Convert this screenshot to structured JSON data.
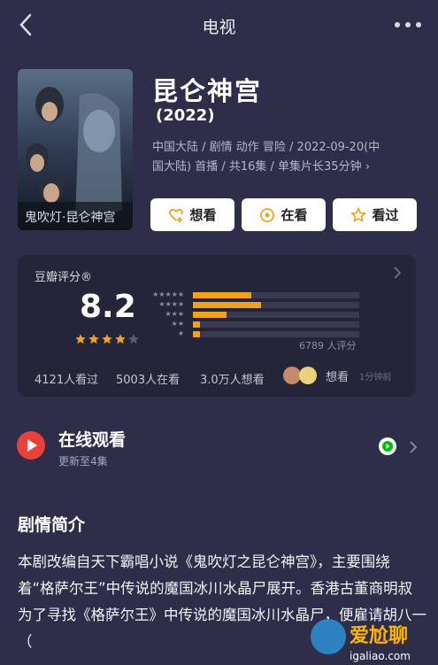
{
  "header": {
    "title": "电视"
  },
  "movie": {
    "title": "昆仑神宫",
    "year": "(2022)",
    "meta_line1": "中国大陆 / 剧情 动作 冒险 / 2022-09-20(中",
    "meta_line2": "国大陆) 首播 / 共16集 / 单集片长35分钟 ›",
    "poster_text": "鬼吹灯·昆仑神宫"
  },
  "actions": {
    "want": "想看",
    "watching": "在看",
    "watched": "看过"
  },
  "rating": {
    "section_title": "豆瓣评分®",
    "score": "8.2",
    "stars": 4,
    "distribution": [
      {
        "stars": "★★★★★",
        "pct": 35
      },
      {
        "stars": "★★★★",
        "pct": 41
      },
      {
        "stars": "★★★",
        "pct": 20
      },
      {
        "stars": "★★",
        "pct": 4
      },
      {
        "stars": "★",
        "pct": 4
      }
    ],
    "count": "6789 人评分",
    "stat_watched": "4121人看过",
    "stat_watching": "5003人在看",
    "stat_want": "3.0万人想看",
    "want_label": "想看",
    "want_time": "1分钟前"
  },
  "online": {
    "title": "在线观看",
    "subtitle": "更新至4集"
  },
  "synopsis": {
    "title": "剧情简介",
    "text": "本剧改编自天下霸唱小说《鬼吹灯之昆仑神宫》，主要围绕着“格萨尔王”中传说的魔国冰川水晶尸展开。香港古董商明叔为了寻找《格萨尔王》中传说的魔国冰川水晶尸，便雇请胡八一（"
  },
  "watermark": {
    "text": "爱尬聊",
    "url": "igaliao.com"
  },
  "colors": {
    "background": "#2e2e4a",
    "card": "#24243a",
    "accent": "#f0a21f",
    "play": "#e8413a"
  }
}
